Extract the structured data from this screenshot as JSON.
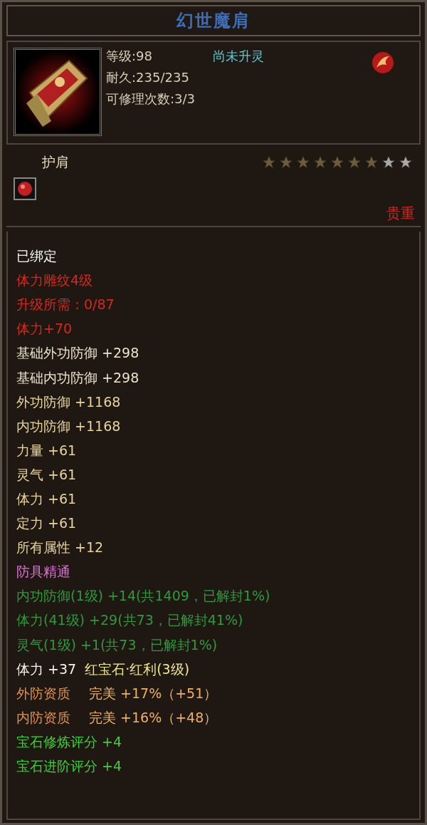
{
  "title": "幻世魔肩",
  "header": {
    "level": "等级:98",
    "spirit": "尚未升灵",
    "durability": "耐久:235/235",
    "repairs": "可修理次数:3/3"
  },
  "type": {
    "label": "护肩",
    "stars": 7,
    "rarity": "贵重"
  },
  "lines": [
    {
      "kind": "bound",
      "text": "已绑定"
    },
    {
      "kind": "carve",
      "text": "体力雕纹4级"
    },
    {
      "kind": "carve",
      "text": "升级所需：0/87"
    },
    {
      "kind": "carve",
      "text": "体力+70"
    },
    {
      "kind": "base",
      "text": "基础外功防御 +298"
    },
    {
      "kind": "base",
      "text": "基础内功防御 +298"
    },
    {
      "kind": "stat",
      "text": "外功防御 +1168"
    },
    {
      "kind": "stat",
      "text": "内功防御 +1168"
    },
    {
      "kind": "stat",
      "text": "力量 +61"
    },
    {
      "kind": "stat",
      "text": "灵气 +61"
    },
    {
      "kind": "stat",
      "text": "体力 +61"
    },
    {
      "kind": "stat",
      "text": "定力 +61"
    },
    {
      "kind": "stat",
      "text": "所有属性 +12"
    },
    {
      "kind": "mastery",
      "text": "防具精通"
    },
    {
      "kind": "seal",
      "text": "内功防御(1级) +14(共1409，已解封1%)"
    },
    {
      "kind": "seal",
      "text": "体力(41级) +29(共73，已解封41%)"
    },
    {
      "kind": "seal",
      "text": "灵气(1级) +1(共73，已解封1%)"
    },
    {
      "kind": "gem",
      "text": "体力 +37",
      "gem": "红宝石·红利(3级)"
    },
    {
      "kind": "quality",
      "text": "外防资质",
      "grade": "完美 +17%（+51）"
    },
    {
      "kind": "quality",
      "text": "内防资质",
      "grade": "完美 +16%（+48）"
    },
    {
      "kind": "score",
      "text": "宝石修炼评分 +4"
    },
    {
      "kind": "score",
      "text": "宝石进阶评分 +4"
    }
  ]
}
